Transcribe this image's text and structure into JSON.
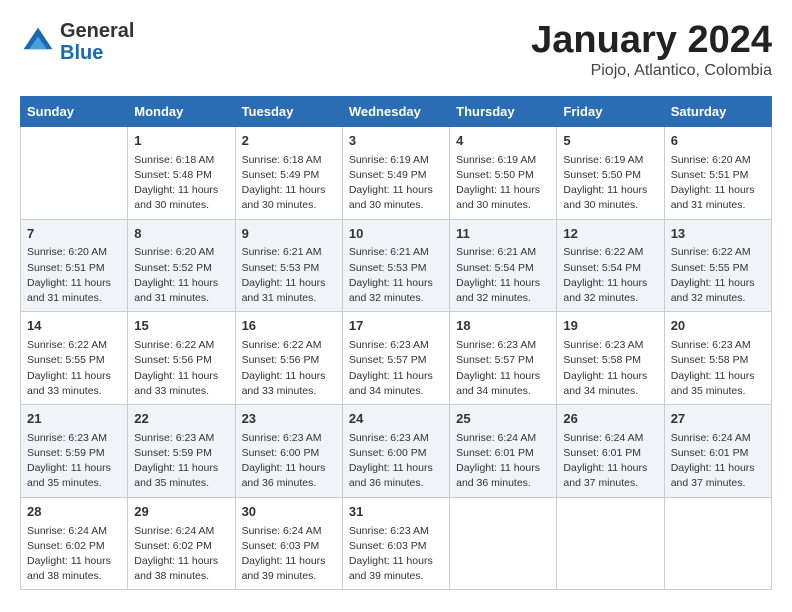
{
  "header": {
    "logo_general": "General",
    "logo_blue": "Blue",
    "month_title": "January 2024",
    "location": "Piojo, Atlantico, Colombia"
  },
  "days_of_week": [
    "Sunday",
    "Monday",
    "Tuesday",
    "Wednesday",
    "Thursday",
    "Friday",
    "Saturday"
  ],
  "weeks": [
    [
      {
        "day": "",
        "info": ""
      },
      {
        "day": "1",
        "info": "Sunrise: 6:18 AM\nSunset: 5:48 PM\nDaylight: 11 hours\nand 30 minutes."
      },
      {
        "day": "2",
        "info": "Sunrise: 6:18 AM\nSunset: 5:49 PM\nDaylight: 11 hours\nand 30 minutes."
      },
      {
        "day": "3",
        "info": "Sunrise: 6:19 AM\nSunset: 5:49 PM\nDaylight: 11 hours\nand 30 minutes."
      },
      {
        "day": "4",
        "info": "Sunrise: 6:19 AM\nSunset: 5:50 PM\nDaylight: 11 hours\nand 30 minutes."
      },
      {
        "day": "5",
        "info": "Sunrise: 6:19 AM\nSunset: 5:50 PM\nDaylight: 11 hours\nand 30 minutes."
      },
      {
        "day": "6",
        "info": "Sunrise: 6:20 AM\nSunset: 5:51 PM\nDaylight: 11 hours\nand 31 minutes."
      }
    ],
    [
      {
        "day": "7",
        "info": "Sunrise: 6:20 AM\nSunset: 5:51 PM\nDaylight: 11 hours\nand 31 minutes."
      },
      {
        "day": "8",
        "info": "Sunrise: 6:20 AM\nSunset: 5:52 PM\nDaylight: 11 hours\nand 31 minutes."
      },
      {
        "day": "9",
        "info": "Sunrise: 6:21 AM\nSunset: 5:53 PM\nDaylight: 11 hours\nand 31 minutes."
      },
      {
        "day": "10",
        "info": "Sunrise: 6:21 AM\nSunset: 5:53 PM\nDaylight: 11 hours\nand 32 minutes."
      },
      {
        "day": "11",
        "info": "Sunrise: 6:21 AM\nSunset: 5:54 PM\nDaylight: 11 hours\nand 32 minutes."
      },
      {
        "day": "12",
        "info": "Sunrise: 6:22 AM\nSunset: 5:54 PM\nDaylight: 11 hours\nand 32 minutes."
      },
      {
        "day": "13",
        "info": "Sunrise: 6:22 AM\nSunset: 5:55 PM\nDaylight: 11 hours\nand 32 minutes."
      }
    ],
    [
      {
        "day": "14",
        "info": "Sunrise: 6:22 AM\nSunset: 5:55 PM\nDaylight: 11 hours\nand 33 minutes."
      },
      {
        "day": "15",
        "info": "Sunrise: 6:22 AM\nSunset: 5:56 PM\nDaylight: 11 hours\nand 33 minutes."
      },
      {
        "day": "16",
        "info": "Sunrise: 6:22 AM\nSunset: 5:56 PM\nDaylight: 11 hours\nand 33 minutes."
      },
      {
        "day": "17",
        "info": "Sunrise: 6:23 AM\nSunset: 5:57 PM\nDaylight: 11 hours\nand 34 minutes."
      },
      {
        "day": "18",
        "info": "Sunrise: 6:23 AM\nSunset: 5:57 PM\nDaylight: 11 hours\nand 34 minutes."
      },
      {
        "day": "19",
        "info": "Sunrise: 6:23 AM\nSunset: 5:58 PM\nDaylight: 11 hours\nand 34 minutes."
      },
      {
        "day": "20",
        "info": "Sunrise: 6:23 AM\nSunset: 5:58 PM\nDaylight: 11 hours\nand 35 minutes."
      }
    ],
    [
      {
        "day": "21",
        "info": "Sunrise: 6:23 AM\nSunset: 5:59 PM\nDaylight: 11 hours\nand 35 minutes."
      },
      {
        "day": "22",
        "info": "Sunrise: 6:23 AM\nSunset: 5:59 PM\nDaylight: 11 hours\nand 35 minutes."
      },
      {
        "day": "23",
        "info": "Sunrise: 6:23 AM\nSunset: 6:00 PM\nDaylight: 11 hours\nand 36 minutes."
      },
      {
        "day": "24",
        "info": "Sunrise: 6:23 AM\nSunset: 6:00 PM\nDaylight: 11 hours\nand 36 minutes."
      },
      {
        "day": "25",
        "info": "Sunrise: 6:24 AM\nSunset: 6:01 PM\nDaylight: 11 hours\nand 36 minutes."
      },
      {
        "day": "26",
        "info": "Sunrise: 6:24 AM\nSunset: 6:01 PM\nDaylight: 11 hours\nand 37 minutes."
      },
      {
        "day": "27",
        "info": "Sunrise: 6:24 AM\nSunset: 6:01 PM\nDaylight: 11 hours\nand 37 minutes."
      }
    ],
    [
      {
        "day": "28",
        "info": "Sunrise: 6:24 AM\nSunset: 6:02 PM\nDaylight: 11 hours\nand 38 minutes."
      },
      {
        "day": "29",
        "info": "Sunrise: 6:24 AM\nSunset: 6:02 PM\nDaylight: 11 hours\nand 38 minutes."
      },
      {
        "day": "30",
        "info": "Sunrise: 6:24 AM\nSunset: 6:03 PM\nDaylight: 11 hours\nand 39 minutes."
      },
      {
        "day": "31",
        "info": "Sunrise: 6:23 AM\nSunset: 6:03 PM\nDaylight: 11 hours\nand 39 minutes."
      },
      {
        "day": "",
        "info": ""
      },
      {
        "day": "",
        "info": ""
      },
      {
        "day": "",
        "info": ""
      }
    ]
  ]
}
